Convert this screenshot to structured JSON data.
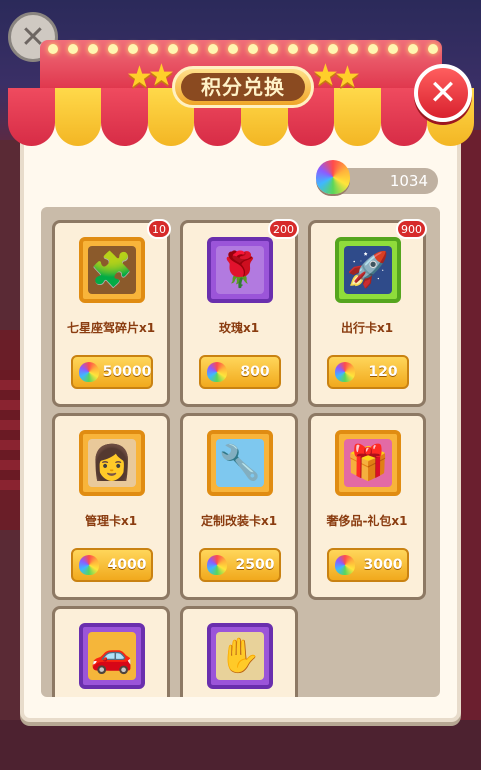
{
  "title": "积分兑换",
  "points": {
    "value": "1034",
    "icon": "rainbow-gem-icon"
  },
  "background_close_icon": "close-icon",
  "close_button_icon": "close-icon",
  "colors": {
    "awning_red": "#e0384e",
    "awning_yellow": "#f3b624",
    "price_gold": "#f1a91d",
    "name_text": "#8a3c10"
  },
  "items": [
    {
      "name": "七星座驾碎片x1",
      "price": "50000",
      "badge": "10",
      "icon": "car-puzzle-piece-icon",
      "frame": "orange"
    },
    {
      "name": "玫瑰x1",
      "price": "800",
      "badge": "200",
      "icon": "rose-icon",
      "frame": "purple"
    },
    {
      "name": "出行卡x1",
      "price": "120",
      "badge": "900",
      "icon": "travel-card-icon",
      "frame": "green"
    },
    {
      "name": "管理卡x1",
      "price": "4000",
      "badge": "",
      "icon": "manager-card-icon",
      "frame": "orange"
    },
    {
      "name": "定制改装卡x1",
      "price": "2500",
      "badge": "",
      "icon": "tools-card-icon",
      "frame": "orange"
    },
    {
      "name": "奢侈品-礼包x1",
      "price": "3000",
      "badge": "",
      "icon": "gift-basket-icon",
      "frame": "orange"
    },
    {
      "name": "",
      "price": "",
      "badge": "",
      "icon": "car-card-icon",
      "frame": "purple"
    },
    {
      "name": "",
      "price": "",
      "badge": "",
      "icon": "hand-coin-icon",
      "frame": "purple"
    }
  ]
}
